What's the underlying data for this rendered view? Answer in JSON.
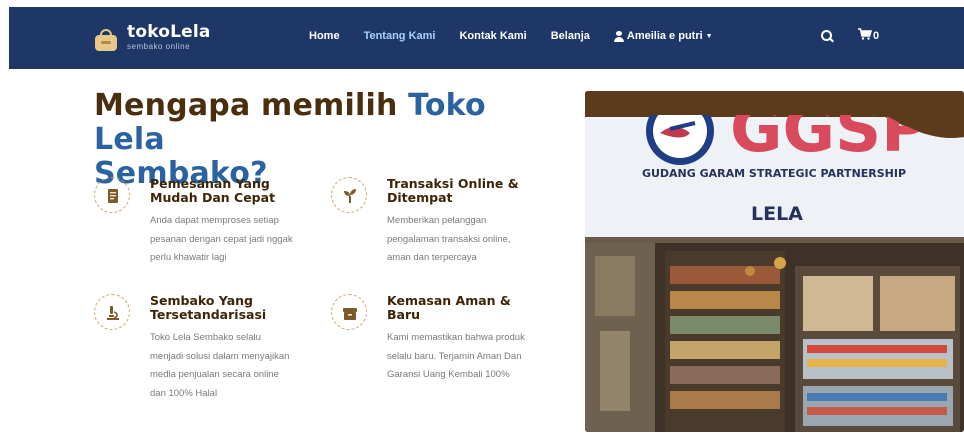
{
  "brand": {
    "name_part1": "toko",
    "name_part2": "Lela",
    "tagline": "sembako online"
  },
  "nav": {
    "links": [
      {
        "label": "Home",
        "active": false
      },
      {
        "label": "Tentang Kami",
        "active": true
      },
      {
        "label": "Kontak Kami",
        "active": false
      },
      {
        "label": "Belanja",
        "active": false
      }
    ],
    "user": "Ameilia e putri",
    "cart_count": "0",
    "icons": [
      "user-icon",
      "caret-down-icon",
      "search-icon",
      "cart-icon"
    ]
  },
  "headline": {
    "part1": "Mengapa memilih ",
    "part2": "Toko Lela",
    "part3": "Sembako?"
  },
  "features": [
    {
      "title_line1": "Pemesanan Yang",
      "title_line2": "Mudah Dan Cepat",
      "desc": [
        "Anda dapat memproses setiap",
        "pesanan dengan cepat jadi nggak",
        "perlu khawatir lagi"
      ],
      "icon": "receipt-icon"
    },
    {
      "title_line1": "Transaksi Online &",
      "title_line2": "Ditempat",
      "desc": [
        "Memberikan pelanggan",
        "pengalaman transaksi online,",
        "aman dan terpercaya"
      ],
      "icon": "sprout-icon"
    },
    {
      "title_line1": "Sembako Yang",
      "title_line2": "Tersetandarisasi",
      "desc": [
        "Toko Lela Sembako selalu",
        "menjadi solusi dalam menyajikan",
        "media penjualan secara online",
        "dan 100% Halal"
      ],
      "icon": "microscope-icon"
    },
    {
      "title_line1": "Kemasan Aman &",
      "title_line2": "Baru",
      "desc": [
        "Kami memastikan bahwa produk",
        "selalu baru. Terjamin Aman Dan",
        "Garansi Uang Kembali 100%"
      ],
      "icon": "package-icon"
    }
  ],
  "photo": {
    "logo_text": "GGSP",
    "banner_text": "GUDANG GARAM STRATEGIC PARTNERSHIP",
    "store_name": "LELA"
  },
  "colors": {
    "navbar": "#1f3767",
    "brown": "#4a2e0e",
    "blue": "#2b62a2",
    "active_link": "#a7d0ff"
  }
}
